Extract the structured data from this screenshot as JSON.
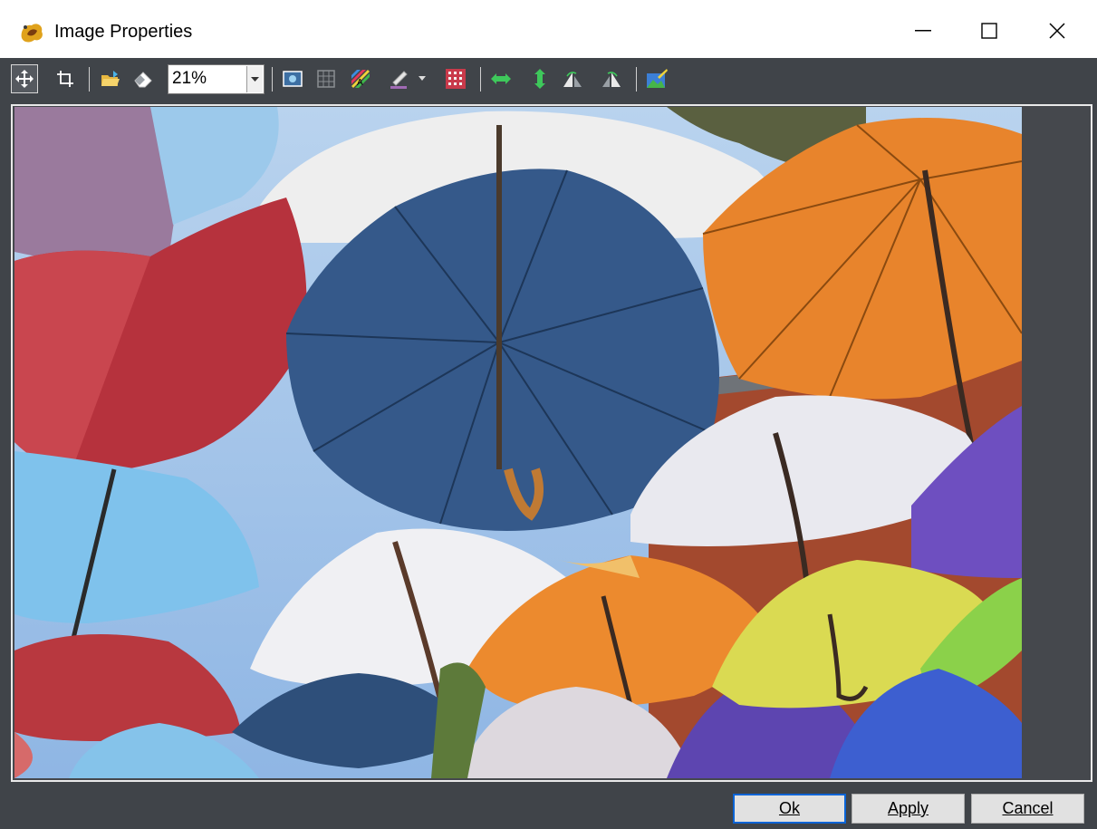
{
  "window": {
    "title": "Image Properties",
    "icon": "paint-splash-icon"
  },
  "window_controls": {
    "minimize": "minimize-icon",
    "maximize": "maximize-icon",
    "close": "close-icon"
  },
  "toolbar": {
    "zoom_value": "21%",
    "tools": [
      "move-icon",
      "crop-icon",
      "open-folder-icon",
      "eraser-icon",
      "fit-screen-icon",
      "grid-select-icon",
      "color-balance-icon",
      "brush-icon",
      "pattern-icon",
      "flip-horizontal-icon",
      "flip-vertical-icon",
      "rotate-left-icon",
      "rotate-right-icon",
      "image-adjust-icon"
    ]
  },
  "canvas": {
    "image": "colorful-umbrellas-photo",
    "background": "#404449"
  },
  "buttons": {
    "ok": "Ok",
    "apply": "Apply",
    "cancel": "Cancel"
  }
}
